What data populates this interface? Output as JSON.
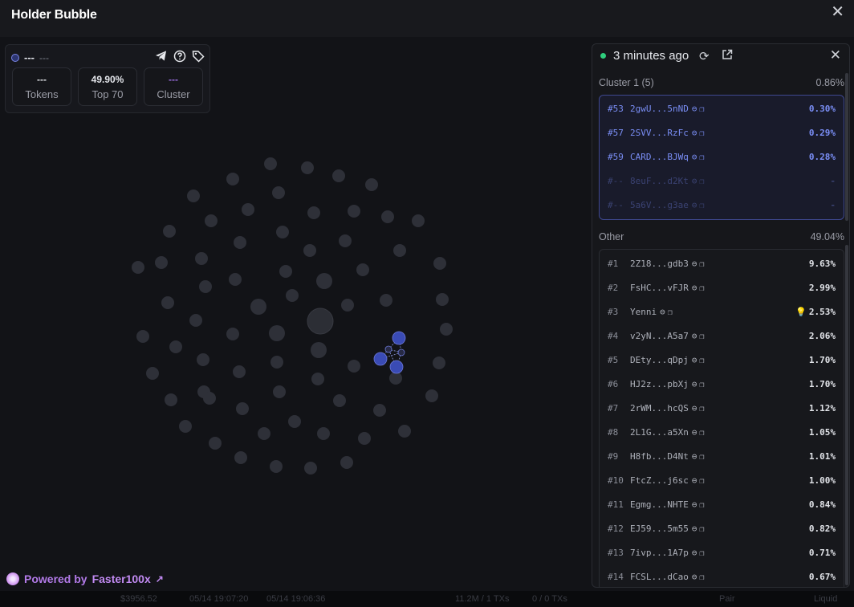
{
  "window": {
    "title": "Holder Bubble",
    "close_icon": "close-icon"
  },
  "token_card": {
    "name": "---",
    "subname": "---",
    "icons": [
      "telegram-icon",
      "help-icon",
      "tag-icon"
    ],
    "stats": [
      {
        "value": "---",
        "label": "Tokens",
        "accent": false
      },
      {
        "value": "49.90%",
        "label": "Top 70",
        "accent": false
      },
      {
        "value": "---",
        "label": "Cluster",
        "accent": true
      }
    ]
  },
  "panel": {
    "updated": "3 minutes ago",
    "cluster": {
      "title": "Cluster 1 (5)",
      "percent": "0.86%",
      "rows": [
        {
          "rank": "#53",
          "address": "2gwU...5nND",
          "value": "0.30%",
          "dim": false
        },
        {
          "rank": "#57",
          "address": "2SVV...RzFc",
          "value": "0.29%",
          "dim": false
        },
        {
          "rank": "#59",
          "address": "CARD...BJWq",
          "value": "0.28%",
          "dim": false
        },
        {
          "rank": "#--",
          "address": "8euF...d2Kt",
          "value": "-",
          "dim": true
        },
        {
          "rank": "#--",
          "address": "5a6V...g3ae",
          "value": "-",
          "dim": true
        }
      ]
    },
    "other": {
      "title": "Other",
      "percent": "49.04%",
      "rows": [
        {
          "rank": "#1",
          "address": "2Z18...gdb3",
          "value": "9.63%"
        },
        {
          "rank": "#2",
          "address": "FsHC...vFJR",
          "value": "2.99%"
        },
        {
          "rank": "#3",
          "address": "Yenni",
          "value": "2.53%",
          "bulb": true
        },
        {
          "rank": "#4",
          "address": "v2yN...A5a7",
          "value": "2.06%"
        },
        {
          "rank": "#5",
          "address": "DEty...qDpj",
          "value": "1.70%"
        },
        {
          "rank": "#6",
          "address": "HJ2z...pbXj",
          "value": "1.70%"
        },
        {
          "rank": "#7",
          "address": "2rWM...hcQS",
          "value": "1.12%"
        },
        {
          "rank": "#8",
          "address": "2L1G...a5Xn",
          "value": "1.05%"
        },
        {
          "rank": "#9",
          "address": "H8fb...D4Nt",
          "value": "1.01%"
        },
        {
          "rank": "#10",
          "address": "FtcZ...j6sc",
          "value": "1.00%"
        },
        {
          "rank": "#11",
          "address": "Egmg...NHTE",
          "value": "0.84%"
        },
        {
          "rank": "#12",
          "address": "EJ59...5m55",
          "value": "0.82%"
        },
        {
          "rank": "#13",
          "address": "7ivp...1A7p",
          "value": "0.71%"
        },
        {
          "rank": "#14",
          "address": "FCSL...dCao",
          "value": "0.67%"
        }
      ]
    }
  },
  "footer": {
    "prefix": "Powered by",
    "brand": "Faster100x"
  },
  "background_strip": [
    "$3956.52",
    "05/14 19:07:20",
    "05/14 19:06:36",
    "11.2M / 1 TXs",
    "0 / 0 TXs",
    "Pair",
    "Liquid"
  ],
  "colors": {
    "bubble": "#2e3038",
    "cluster_bubble": "#3a4bb5",
    "accent": "#7a8ef5",
    "live": "#2fcf7e",
    "brand": "#c18af2"
  }
}
